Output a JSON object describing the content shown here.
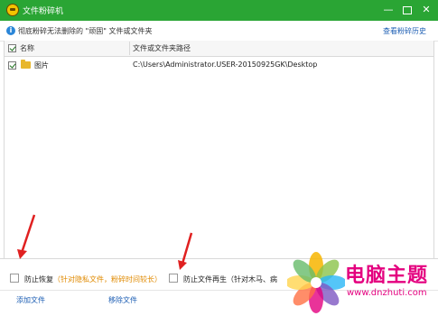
{
  "titlebar": {
    "title": "文件粉碎机",
    "minimize": "—",
    "close": "✕"
  },
  "infobar": {
    "message": "彻底粉碎无法删除的 \"顽固\" 文件或文件夹",
    "history_link": "查看粉碎历史"
  },
  "table": {
    "columns": [
      "名称",
      "文件或文件夹路径"
    ],
    "rows": [
      {
        "checked": true,
        "name": "图片",
        "path": "C:\\Users\\Administrator.USER-20150925GK\\Desktop",
        "icon": "folder-icon"
      }
    ]
  },
  "options": {
    "prevent_recovery": {
      "label": "防止恢复",
      "hint": "（针对隐私文件，粉碎时间较长）"
    },
    "prevent_regen": {
      "label": "防止文件再生（针对木马、病"
    }
  },
  "actions": {
    "add": "添加文件",
    "remove": "移除文件"
  },
  "watermark": {
    "title": "电脑主题",
    "url": "www.dnzhuti.com"
  },
  "colors": {
    "titlebar": "#2aa534",
    "link": "#1e5fb4",
    "hint": "#e08a00",
    "annotation_arrow": "#e02020",
    "watermark": "#e4007f"
  }
}
